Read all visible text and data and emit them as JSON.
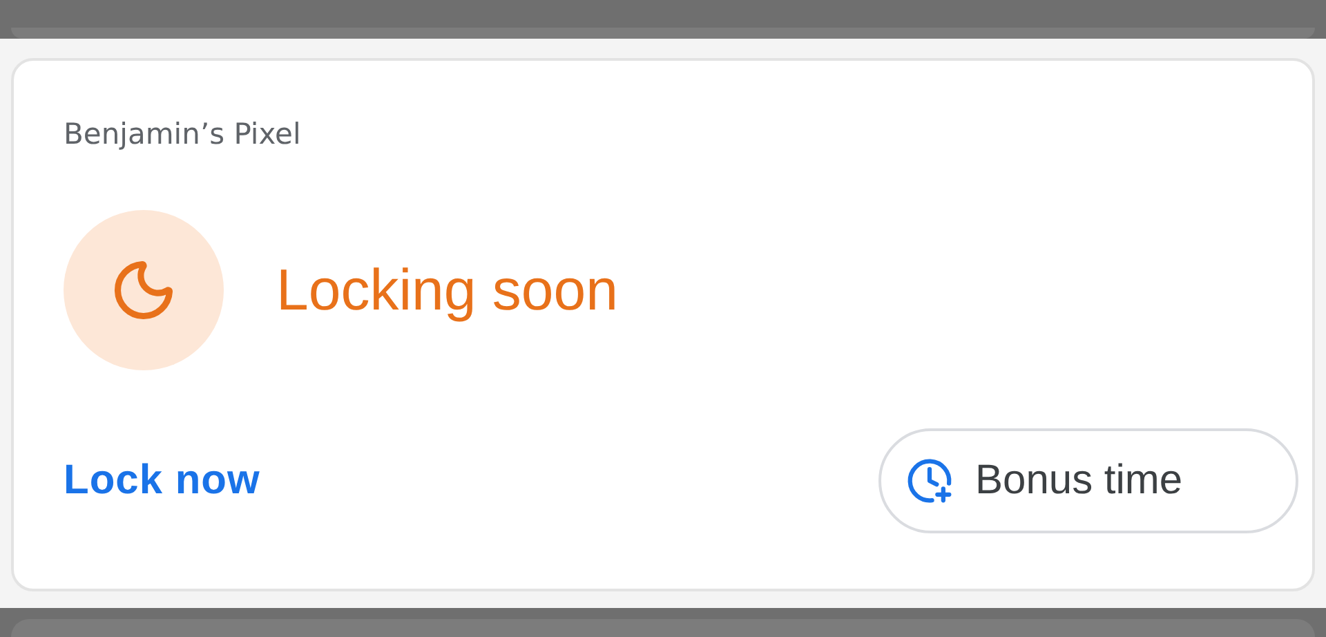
{
  "card": {
    "device_name": "Benjamin’s Pixel",
    "status": "Locking soon",
    "lock_link": "Lock now",
    "bonus_button": "Bonus time"
  }
}
